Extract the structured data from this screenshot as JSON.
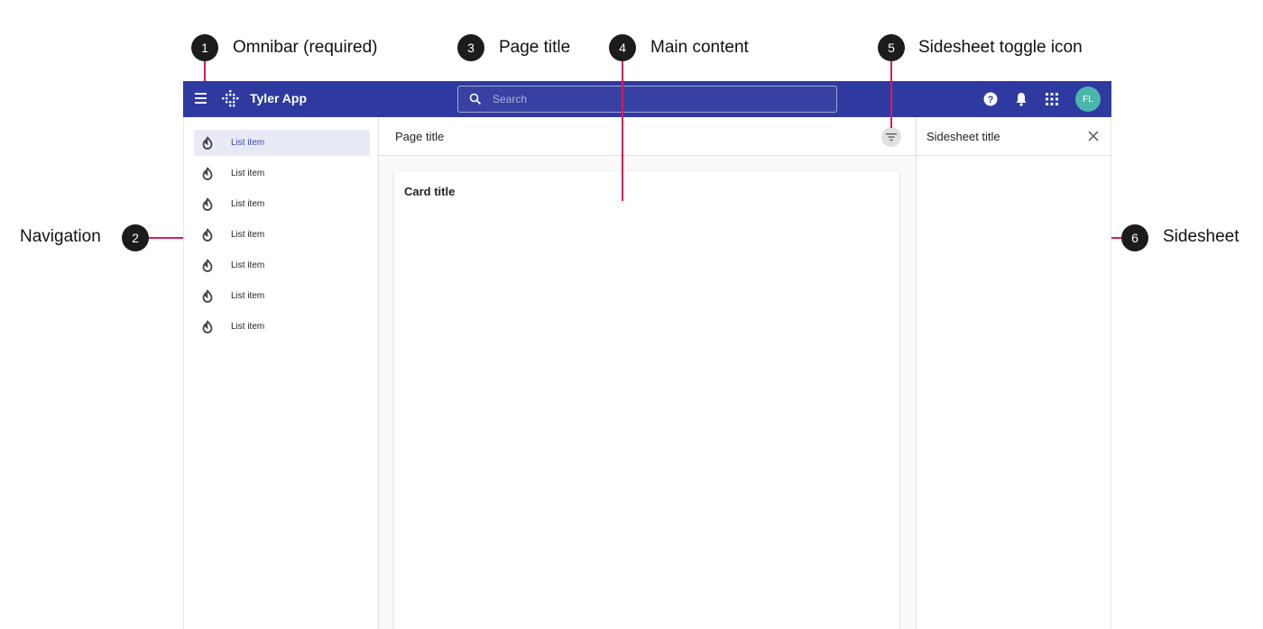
{
  "callouts": [
    {
      "number": "1",
      "label": "Omnibar (required)"
    },
    {
      "number": "2",
      "label": "Navigation"
    },
    {
      "number": "3",
      "label": "Page title"
    },
    {
      "number": "4",
      "label": "Main content"
    },
    {
      "number": "5",
      "label": "Sidesheet toggle icon"
    },
    {
      "number": "6",
      "label": "Sidesheet"
    }
  ],
  "omnibar": {
    "app_name": "Tyler App",
    "search_placeholder": "Search",
    "avatar_initials": "FL",
    "actions": [
      "help-icon",
      "bell-icon",
      "apps-grid-icon"
    ],
    "background": "#2e3a9f",
    "avatar_color": "#4db6ac"
  },
  "navigation": {
    "items": [
      {
        "label": "List item",
        "icon": "fire-icon",
        "active": true
      },
      {
        "label": "List item",
        "icon": "fire-icon",
        "active": false
      },
      {
        "label": "List item",
        "icon": "fire-icon",
        "active": false
      },
      {
        "label": "List item",
        "icon": "fire-icon",
        "active": false
      },
      {
        "label": "List item",
        "icon": "fire-icon",
        "active": false
      },
      {
        "label": "List item",
        "icon": "fire-icon",
        "active": false
      },
      {
        "label": "List item",
        "icon": "fire-icon",
        "active": false
      }
    ],
    "active_color": "#3949ab"
  },
  "main": {
    "page_title": "Page title",
    "card_title": "Card title",
    "toggle_icon": "filter-icon"
  },
  "sidesheet": {
    "title": "Sidesheet title",
    "close_icon": "close-icon"
  },
  "accent": {
    "callout_line": "#d81b60",
    "badge": "#1c1c1c"
  }
}
